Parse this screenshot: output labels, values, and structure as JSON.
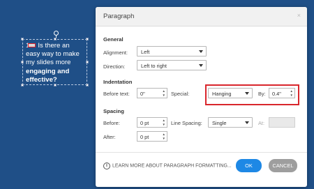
{
  "slide": {
    "line1_prefix": "1",
    "line1_rest": "Is there an",
    "line2": "easy way to make",
    "line3": "my slides more",
    "line4": "engaging and",
    "line5": "effective?"
  },
  "dialog": {
    "title": "Paragraph",
    "close": "×",
    "general": {
      "heading": "General",
      "alignment_label": "Alignment:",
      "alignment_value": "Left",
      "direction_label": "Direction:",
      "direction_value": "Left to right"
    },
    "indentation": {
      "heading": "Indentation",
      "before_text_label": "Before text:",
      "before_text_value": "0\"",
      "special_label": "Special:",
      "special_value": "Hanging",
      "by_label": "By:",
      "by_value": "0.4\""
    },
    "spacing": {
      "heading": "Spacing",
      "before_label": "Before:",
      "before_value": "0 pt",
      "line_spacing_label": "Line Spacing:",
      "line_spacing_value": "Single",
      "at_label": "At:",
      "at_value": "",
      "after_label": "After:",
      "after_value": "0 pt"
    },
    "footer": {
      "info_text": "LEARN MORE ABOUT PARAGRAPH FORMATTING...",
      "ok_label": "OK",
      "cancel_label": "CANCEL"
    }
  },
  "colors": {
    "background": "#1f4f87",
    "highlight": "#d9262c",
    "ok_button": "#1e88e5",
    "cancel_button": "#9e9e9e"
  }
}
